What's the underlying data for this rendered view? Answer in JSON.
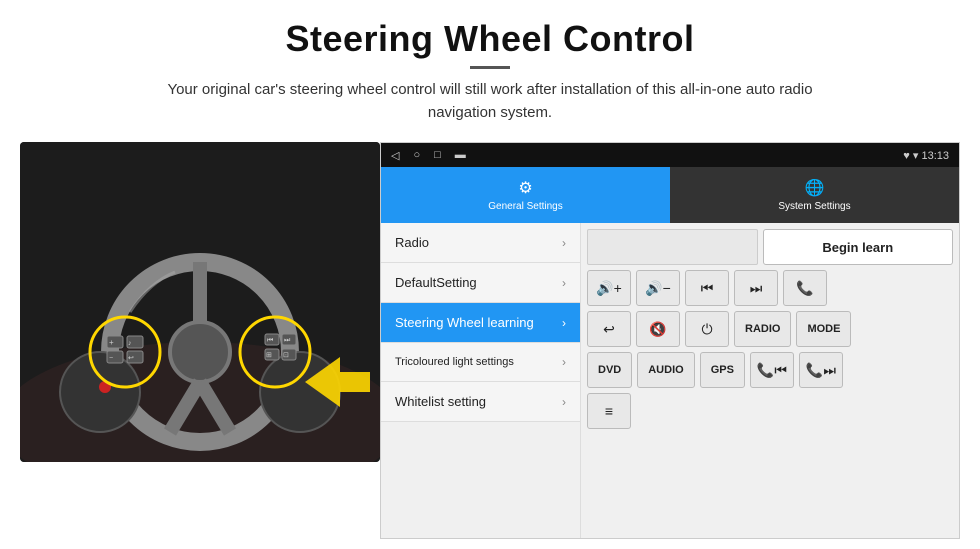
{
  "header": {
    "title": "Steering Wheel Control",
    "subtitle": "Your original car's steering wheel control will still work after installation of this all-in-one auto radio navigation system."
  },
  "status_bar": {
    "icons": [
      "◁",
      "○",
      "□",
      "▬"
    ],
    "right": "♥ ▾  13:13"
  },
  "tabs": [
    {
      "id": "general",
      "icon": "⚙",
      "label": "General Settings",
      "active": true
    },
    {
      "id": "system",
      "icon": "🌐",
      "label": "System Settings",
      "active": false
    }
  ],
  "menu_items": [
    {
      "label": "Radio",
      "active": false
    },
    {
      "label": "DefaultSetting",
      "active": false
    },
    {
      "label": "Steering Wheel learning",
      "active": true
    },
    {
      "label": "Tricoloured light settings",
      "active": false
    },
    {
      "label": "Whitelist setting",
      "active": false
    }
  ],
  "controls": {
    "begin_learn_label": "Begin learn",
    "row1": [
      "🔊+",
      "🔊−",
      "⏮",
      "⏭",
      "📞"
    ],
    "row2": [
      "↩",
      "🔊✕",
      "⏻",
      "RADIO",
      "MODE"
    ],
    "row3": [
      "DVD",
      "AUDIO",
      "GPS",
      "📞⏮",
      "📞⏭"
    ],
    "row4_icon": "≡"
  }
}
